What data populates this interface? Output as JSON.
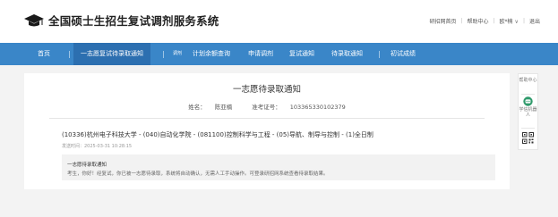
{
  "header": {
    "title": "全国硕士生招生复试调剂服务系统",
    "links": [
      {
        "label": "研招网首页"
      },
      {
        "label": "帮助中心"
      },
      {
        "label": "欧*楠"
      },
      {
        "label": "退出"
      }
    ]
  },
  "nav": {
    "items": [
      {
        "label": "首页"
      },
      {
        "label": "一志愿复试待录取通知"
      },
      {
        "label": "调剂"
      },
      {
        "label": "计划余额查询"
      },
      {
        "label": "申请调剂"
      },
      {
        "label": "复试通知"
      },
      {
        "label": "待录取通知"
      },
      {
        "label": "初试成绩"
      }
    ],
    "active_index": 1
  },
  "main": {
    "title": "一志愿待录取通知",
    "name_label": "姓名：",
    "name_value": "陈亚楠",
    "exam_no_label": "准考证号：",
    "exam_no_value": "103365330102379",
    "program": "(10336)杭州电子科技大学 - (040)自动化学院 - (081100)控制科学与工程 - (05)导航、制导与控制 - (1)全日制",
    "send_time": "发送时间：2025-03-31 10:28:15",
    "notice_title": "一志愿待录取通知",
    "notice_body": "考生，你好！经复试，你已被一志愿待录取，系统将自动确认，无需人工手动操作。可登录研招网系统查看待录取结果。"
  },
  "side": {
    "help_label": "帮助中心",
    "robot_label": "学信机器人"
  },
  "colors": {
    "nav_bg": "#3a86c8",
    "nav_active_bg": "#2c6fb0",
    "page_bg": "#f3f3f3"
  }
}
